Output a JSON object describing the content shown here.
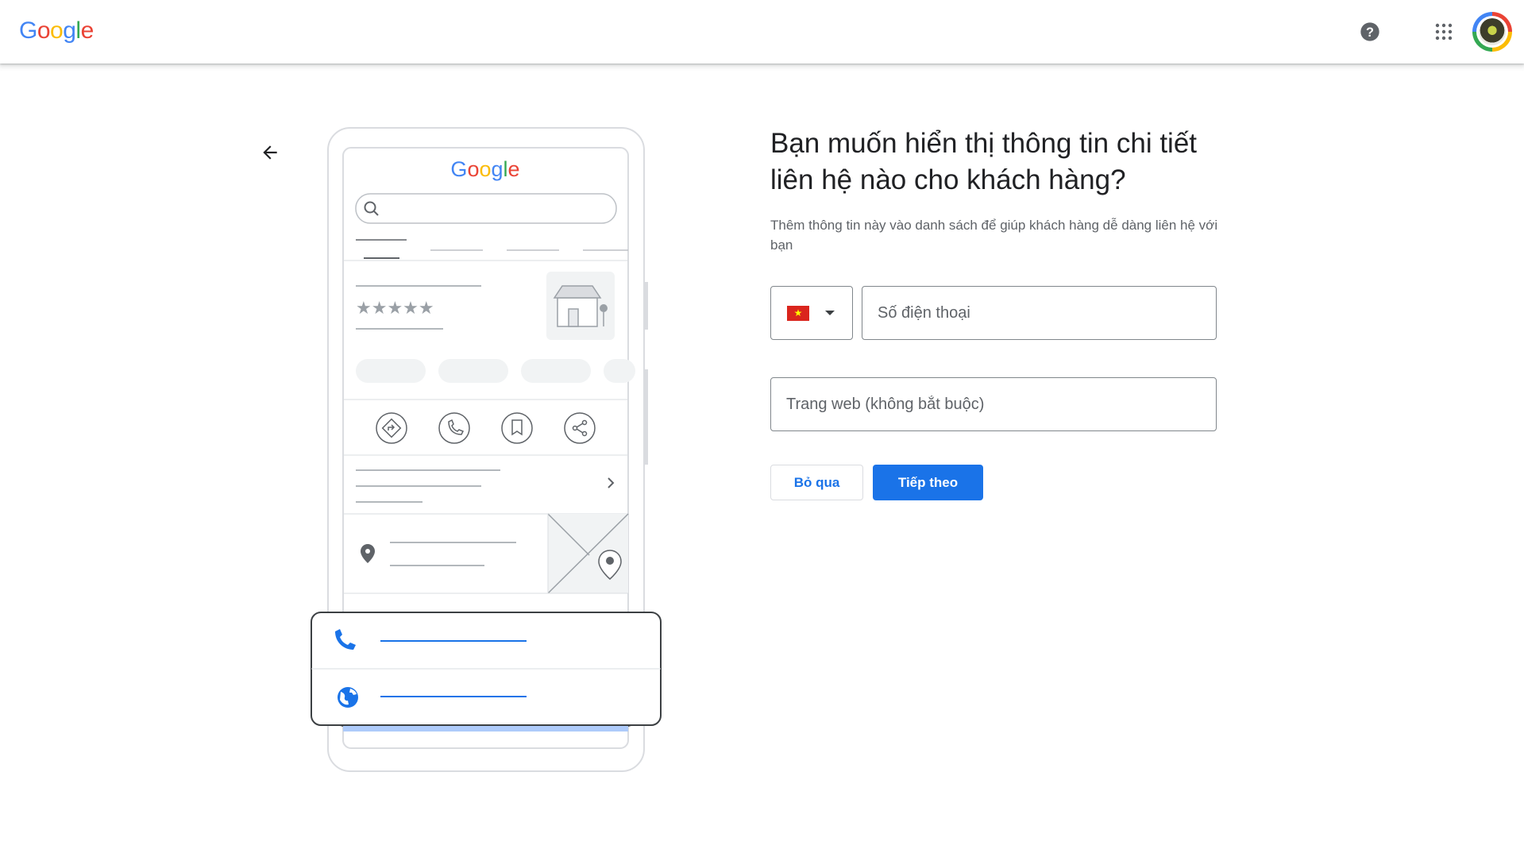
{
  "header": {
    "logo": {
      "letters": [
        "G",
        "o",
        "o",
        "g",
        "l",
        "e"
      ],
      "colors": [
        "#4285f4",
        "#ea4335",
        "#fbbc05",
        "#4285f4",
        "#34a853",
        "#ea4335"
      ]
    },
    "icons": [
      "help-icon",
      "apps-grid-icon",
      "account-avatar"
    ]
  },
  "illustration": {
    "logo_text": "Google",
    "rating_stars": 5,
    "action_icons": [
      "directions-icon",
      "phone-icon",
      "bookmark-icon",
      "share-icon"
    ],
    "card_icons": [
      "phone-icon",
      "globe-icon"
    ],
    "accent_color": "#1a73e8"
  },
  "main": {
    "title": "Bạn muốn hiển thị thông tin chi tiết liên hệ nào cho khách hàng?",
    "subtitle": "Thêm thông tin này vào danh sách để giúp khách hàng dễ dàng liên hệ với bạn",
    "country": {
      "flag": "vietnam-flag-icon",
      "flag_color": "#da251d"
    },
    "phone": {
      "placeholder": "Số điện thoại",
      "value": ""
    },
    "website": {
      "placeholder": "Trang web (không bắt buộc)",
      "value": ""
    },
    "buttons": {
      "skip": "Bỏ qua",
      "next": "Tiếp theo"
    }
  }
}
